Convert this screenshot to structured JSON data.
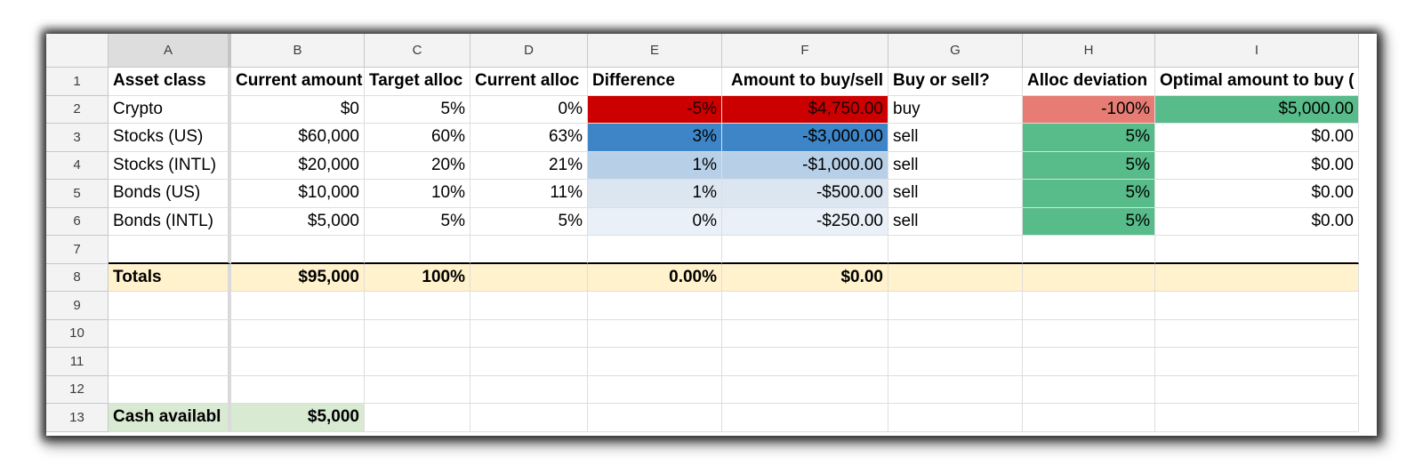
{
  "columns": [
    "A",
    "B",
    "C",
    "D",
    "E",
    "F",
    "G",
    "H",
    "I"
  ],
  "rows": [
    "1",
    "2",
    "3",
    "4",
    "5",
    "6",
    "7",
    "8",
    "9",
    "10",
    "11",
    "12",
    "13"
  ],
  "headers": {
    "asset_class": "Asset class",
    "current_amount": "Current amount",
    "target_alloc": "Target alloc",
    "current_alloc": "Current alloc",
    "difference": "Difference",
    "amount_to_buy_sell": "Amount to buy/sell",
    "buy_or_sell": "Buy or sell?",
    "alloc_deviation": "Alloc deviation",
    "optimal_amount": "Optimal amount to buy ("
  },
  "assets": [
    {
      "name": "Crypto",
      "current_amount": "$0",
      "target_alloc": "5%",
      "current_alloc": "0%",
      "difference": "-5%",
      "amount": "$4,750.00",
      "action": "buy",
      "deviation": "-100%",
      "optimal": "$5,000.00"
    },
    {
      "name": "Stocks (US)",
      "current_amount": "$60,000",
      "target_alloc": "60%",
      "current_alloc": "63%",
      "difference": "3%",
      "amount": "-$3,000.00",
      "action": "sell",
      "deviation": "5%",
      "optimal": "$0.00"
    },
    {
      "name": "Stocks (INTL)",
      "current_amount": "$20,000",
      "target_alloc": "20%",
      "current_alloc": "21%",
      "difference": "1%",
      "amount": "-$1,000.00",
      "action": "sell",
      "deviation": "5%",
      "optimal": "$0.00"
    },
    {
      "name": "Bonds (US)",
      "current_amount": "$10,000",
      "target_alloc": "10%",
      "current_alloc": "11%",
      "difference": "1%",
      "amount": "-$500.00",
      "action": "sell",
      "deviation": "5%",
      "optimal": "$0.00"
    },
    {
      "name": "Bonds (INTL)",
      "current_amount": "$5,000",
      "target_alloc": "5%",
      "current_alloc": "5%",
      "difference": "0%",
      "amount": "-$250.00",
      "action": "sell",
      "deviation": "5%",
      "optimal": "$0.00"
    }
  ],
  "totals": {
    "label": "Totals",
    "current_amount": "$95,000",
    "target_alloc": "100%",
    "difference": "0.00%",
    "amount": "$0.00"
  },
  "cash": {
    "label": "Cash availabl",
    "value": "$5,000"
  },
  "colors": {
    "red": "#cc0000",
    "blue_strong": "#3d85c6",
    "blue_light": "#b7d0e8",
    "salmon": "#e67c73",
    "green": "#57bb8a",
    "totals_bg": "#fff2cc",
    "cash_bg": "#d9ead3"
  }
}
